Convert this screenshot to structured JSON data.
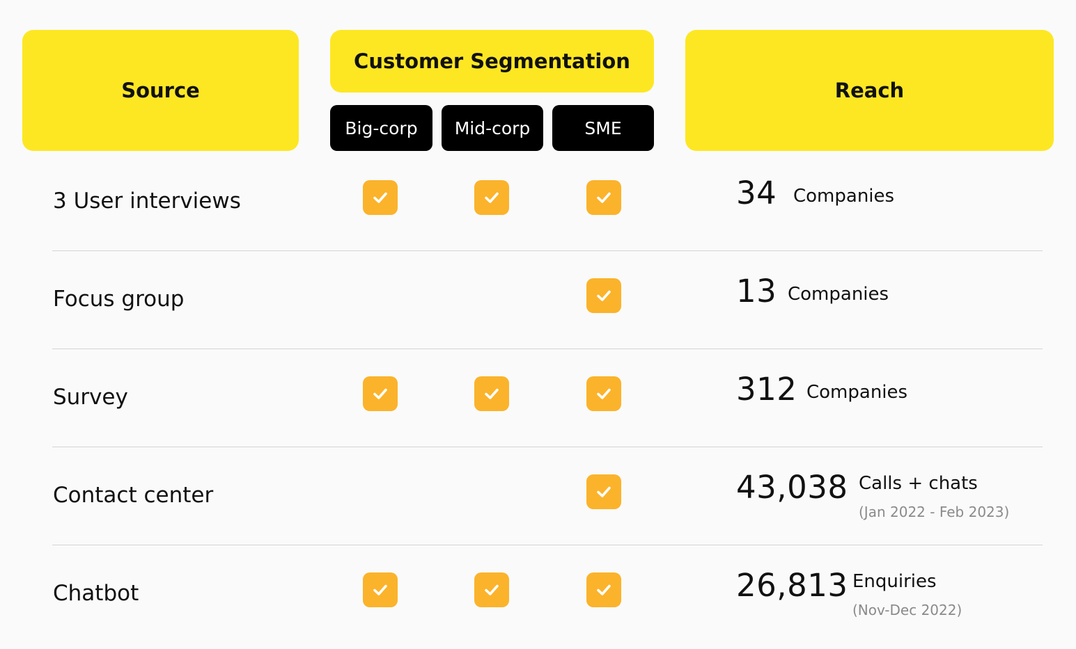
{
  "headers": {
    "source": "Source",
    "segmentation": "Customer Segmentation",
    "reach": "Reach"
  },
  "segments": [
    "Big-corp",
    "Mid-corp",
    "SME"
  ],
  "colors": {
    "header_bg": "#fde723",
    "segment_bg": "#000000",
    "check_bg": "#fbb32b",
    "divider": "#d4d4d4"
  },
  "rows": [
    {
      "source": "3 User interviews",
      "checks": [
        true,
        true,
        true
      ],
      "reach_value": "34",
      "reach_unit": "Companies",
      "reach_note": ""
    },
    {
      "source": "Focus group",
      "checks": [
        false,
        false,
        true
      ],
      "reach_value": "13",
      "reach_unit": "Companies",
      "reach_note": ""
    },
    {
      "source": "Survey",
      "checks": [
        true,
        true,
        true
      ],
      "reach_value": "312",
      "reach_unit": "Companies",
      "reach_note": ""
    },
    {
      "source": "Contact center",
      "checks": [
        false,
        false,
        true
      ],
      "reach_value": "43,038",
      "reach_unit": "Calls + chats",
      "reach_note": "(Jan 2022 - Feb 2023)"
    },
    {
      "source": "Chatbot",
      "checks": [
        true,
        true,
        true
      ],
      "reach_value": "26,813",
      "reach_unit": "Enquiries",
      "reach_note": "(Nov-Dec 2022)"
    }
  ]
}
